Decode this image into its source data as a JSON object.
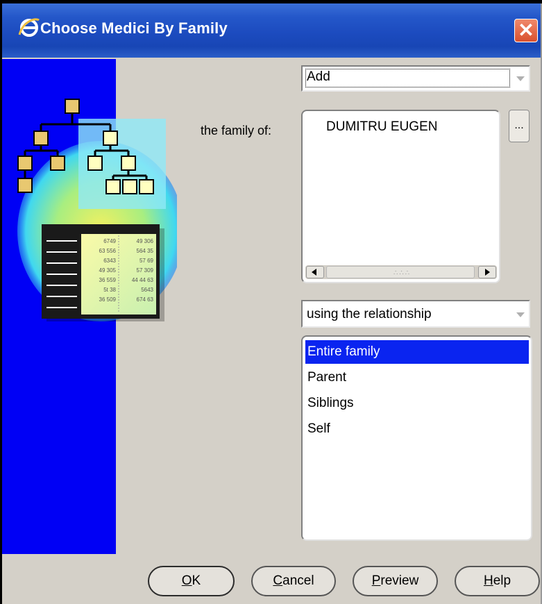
{
  "window": {
    "title": "Choose Medici By Family",
    "close_symbol": "✕"
  },
  "action_combo": {
    "value": "Add"
  },
  "family": {
    "label": "the family of:",
    "value": "DUMITRU EUGEN",
    "browse_label": "..."
  },
  "relationship_combo": {
    "value": "using the relationship"
  },
  "relationships": [
    {
      "label": "Entire family",
      "selected": true
    },
    {
      "label": "Parent",
      "selected": false
    },
    {
      "label": "Siblings",
      "selected": false
    },
    {
      "label": "Self",
      "selected": false
    }
  ],
  "decor_numbers": {
    "left": [
      "6749",
      "63 556",
      "6343",
      "49 305",
      "36 559",
      "5t 38",
      "36 509"
    ],
    "right": [
      "49 306",
      "564 35",
      "57 69",
      "57 309",
      "44 44 63",
      "5643",
      "674 63"
    ]
  },
  "buttons": {
    "ok": {
      "mnemonic": "O",
      "rest": "K"
    },
    "cancel": {
      "mnemonic": "C",
      "rest": "ancel"
    },
    "preview": {
      "mnemonic": "P",
      "rest": "review"
    },
    "help": {
      "mnemonic": "H",
      "rest": "elp"
    }
  },
  "colors": {
    "titlebar": "#2457c9",
    "side_panel": "#0000f5",
    "selection": "#0a24f0",
    "dialog_bg": "#d4d0c8",
    "close_button": "#d9502e"
  },
  "icons": {
    "title": "ie-logo-icon",
    "close": "close-icon",
    "combo_arrow": "chevron-down-icon",
    "scroll_left": "scroll-left-icon",
    "scroll_right": "scroll-right-icon",
    "art": "family-tree-illustration"
  }
}
